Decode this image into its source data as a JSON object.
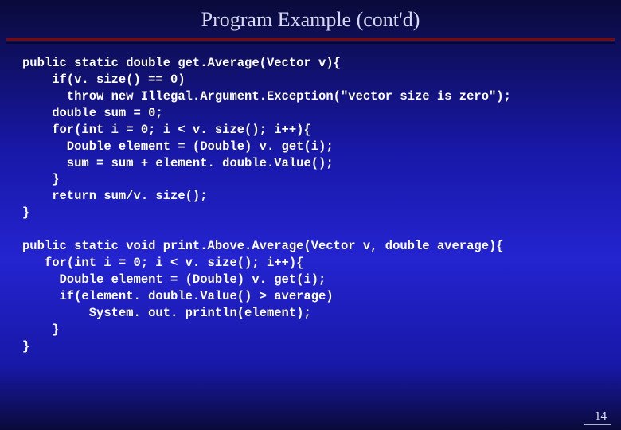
{
  "slide": {
    "title": "Program Example (cont'd)",
    "page_number": "14"
  },
  "code": {
    "l1": "public static double get.Average(Vector v){",
    "l2": "    if(v. size() == 0)",
    "l3": "      throw new Illegal.Argument.Exception(\"vector size is zero\");",
    "l4": "    double sum = 0;",
    "l5": "    for(int i = 0; i < v. size(); i++){",
    "l6": "      Double element = (Double) v. get(i);",
    "l7": "      sum = sum + element. double.Value();",
    "l8": "    }",
    "l9": "    return sum/v. size();",
    "l10": "}",
    "l11": "",
    "l12": "public static void print.Above.Average(Vector v, double average){",
    "l13": "   for(int i = 0; i < v. size(); i++){",
    "l14": "     Double element = (Double) v. get(i);",
    "l15": "     if(element. double.Value() > average)",
    "l16": "         System. out. println(element);",
    "l17": "    }",
    "l18": "}"
  }
}
